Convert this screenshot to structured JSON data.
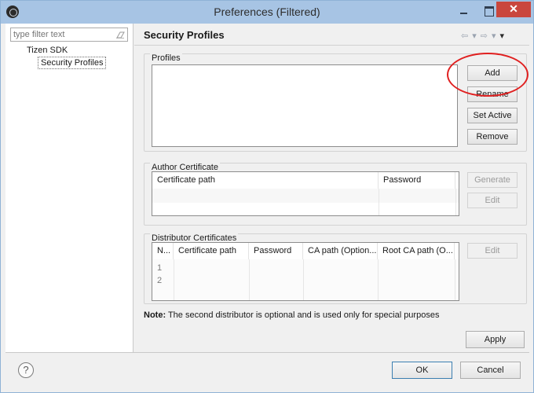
{
  "window": {
    "title": "Preferences (Filtered)",
    "close_glyph": "✕"
  },
  "filter": {
    "placeholder": "type filter text",
    "clear_icon": "eraser-icon"
  },
  "tree": {
    "root": "Tizen SDK",
    "selected_child": "Security Profiles"
  },
  "page": {
    "title": "Security Profiles",
    "nav_back": "⇦",
    "nav_forward": "⇨",
    "nav_menu": "▾"
  },
  "profiles": {
    "group_label": "Profiles",
    "buttons": {
      "add": "Add",
      "rename": "Rename",
      "set_active": "Set Active",
      "remove": "Remove"
    }
  },
  "author": {
    "group_label": "Author Certificate",
    "columns": [
      "Certificate path",
      "Password"
    ],
    "buttons": {
      "generate": "Generate",
      "edit": "Edit"
    }
  },
  "distributor": {
    "group_label": "Distributor Certificates",
    "columns": [
      "N...",
      "Certificate path",
      "Password",
      "CA path (Option...",
      "Root CA path (O..."
    ],
    "rows": [
      "1",
      "2"
    ],
    "buttons": {
      "edit": "Edit"
    }
  },
  "note": {
    "label": "Note:",
    "text": " The second distributor is optional and is used only for special purposes"
  },
  "footer": {
    "apply": "Apply",
    "ok": "OK",
    "cancel": "Cancel",
    "help": "?"
  },
  "colors": {
    "titlebar": "#a7c4e4",
    "close": "#c9463d",
    "highlight_ring": "#e02020"
  }
}
